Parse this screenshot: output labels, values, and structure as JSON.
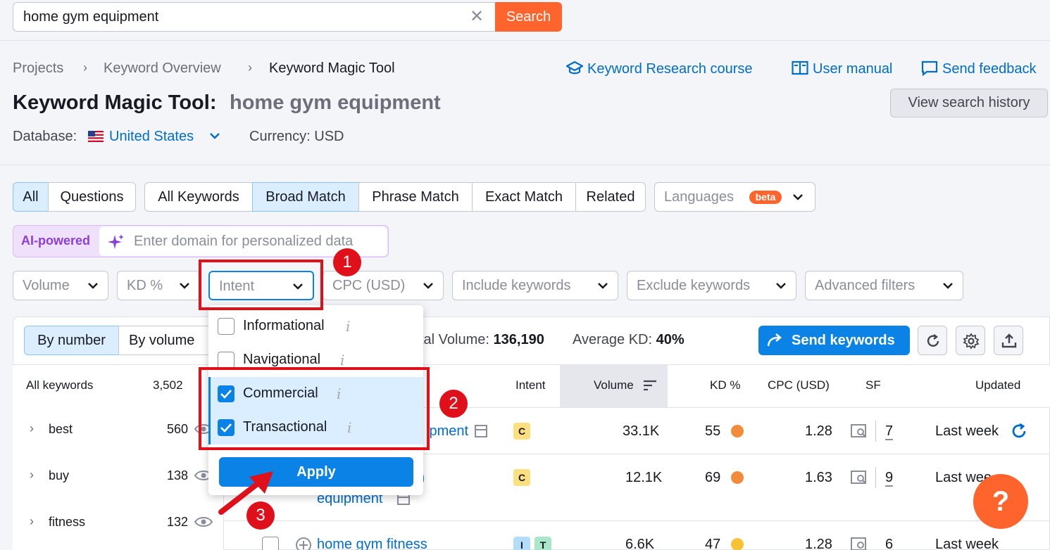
{
  "search": {
    "value": "home gym equipment",
    "clear_icon": "close-icon",
    "button": "Search"
  },
  "breadcrumb": [
    "Projects",
    "Keyword Overview",
    "Keyword Magic Tool"
  ],
  "header_links": {
    "course": "Keyword Research course",
    "manual": "User manual",
    "feedback": "Send feedback"
  },
  "page": {
    "title": "Keyword Magic Tool:",
    "query": "home gym equipment",
    "history_button": "View search history"
  },
  "database": {
    "label": "Database:",
    "value": "United States",
    "currency": "Currency: USD"
  },
  "tabs_group1": [
    "All",
    "Questions"
  ],
  "tabs_group2": [
    "All Keywords",
    "Broad Match",
    "Phrase Match",
    "Exact Match",
    "Related"
  ],
  "languages": {
    "label": "Languages",
    "badge": "beta"
  },
  "ai": {
    "label": "AI-powered",
    "placeholder": "Enter domain for personalized data"
  },
  "filters": [
    "Volume",
    "KD %",
    "Intent",
    "CPC (USD)",
    "Include keywords",
    "Exclude keywords",
    "Advanced filters"
  ],
  "view_toggle": [
    "By number",
    "By volume"
  ],
  "summary": {
    "total_volume_label": "tal Volume:",
    "total_volume": "136,190",
    "avg_kd_label": "Average KD:",
    "avg_kd": "40%",
    "send_button": "Send keywords"
  },
  "groups": {
    "header_label": "All keywords",
    "header_count": "3,502",
    "items": [
      {
        "name": "best",
        "count": "560"
      },
      {
        "name": "buy",
        "count": "138"
      },
      {
        "name": "fitness",
        "count": "132"
      }
    ]
  },
  "table": {
    "headers": {
      "intent": "Intent",
      "volume": "Volume",
      "kd": "KD %",
      "cpc": "CPC (USD)",
      "sf": "SF",
      "updated": "Updated"
    },
    "rows": [
      {
        "keyword": "ipment",
        "intent": [
          "C"
        ],
        "volume": "33.1K",
        "kd": "55",
        "kd_color": "#f28c3c",
        "cpc": "1.28",
        "sf": "7",
        "updated": "Last week"
      },
      {
        "keyword": "n",
        "keyword_line2": "equipment",
        "intent": [
          "C"
        ],
        "volume": "12.1K",
        "kd": "69",
        "kd_color": "#f28c3c",
        "cpc": "1.63",
        "sf": "9",
        "updated": "Last wee"
      },
      {
        "keyword": "home gym fitness",
        "intent": [
          "I",
          "T"
        ],
        "volume": "6.6K",
        "kd": "47",
        "kd_color": "#f5c333",
        "cpc": "1.28",
        "sf": "6",
        "updated": "Last week"
      }
    ]
  },
  "intent_menu": {
    "options": [
      {
        "label": "Informational",
        "checked": false
      },
      {
        "label": "Navigational",
        "checked": false
      },
      {
        "label": "Commercial",
        "checked": true
      },
      {
        "label": "Transactional",
        "checked": true
      }
    ],
    "info_glyph": "i",
    "apply": "Apply"
  },
  "annotations": {
    "step1": "1",
    "step2": "2",
    "step3": "3"
  },
  "help": "?",
  "colors": {
    "accent": "#0a82e6",
    "brand": "#ff642d",
    "annotation": "#e0101b",
    "link": "#006dca"
  }
}
